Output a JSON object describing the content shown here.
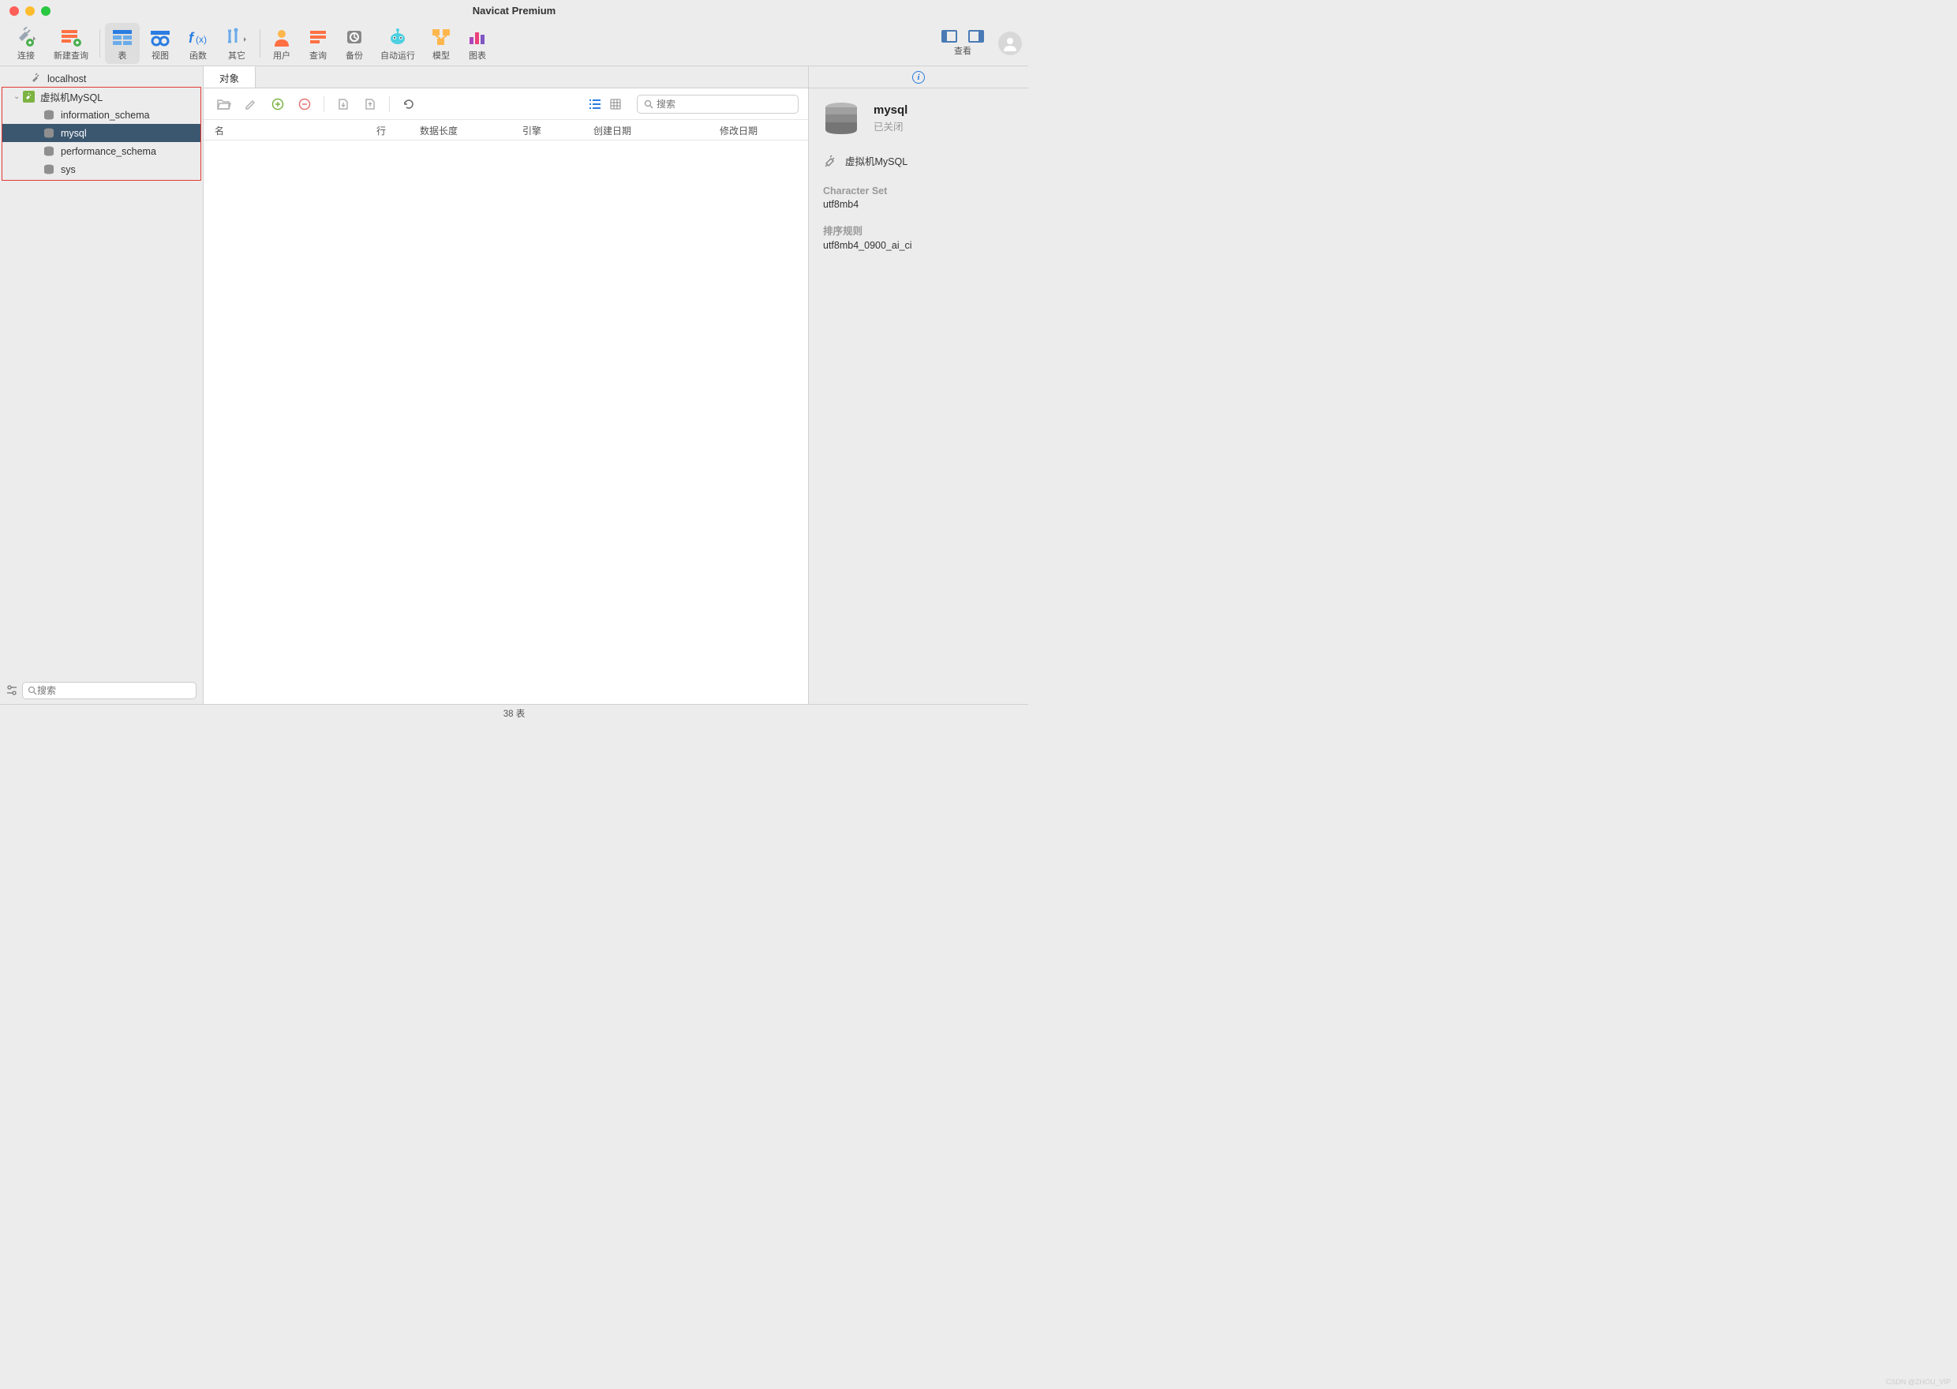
{
  "title": "Navicat Premium",
  "toolbar": {
    "connect": "连接",
    "newquery": "新建查询",
    "table": "表",
    "view": "视图",
    "function": "函数",
    "other": "其它",
    "user": "用户",
    "query": "查询",
    "backup": "备份",
    "automation": "自动运行",
    "model": "模型",
    "chart": "图表",
    "look": "查看"
  },
  "sidebar": {
    "localhost": "localhost",
    "connection": "虚拟机MySQL",
    "databases": [
      "information_schema",
      "mysql",
      "performance_schema",
      "sys"
    ],
    "search_placeholder": "搜索"
  },
  "tabs": {
    "objects": "对象"
  },
  "content": {
    "search_placeholder": "搜索",
    "columns": {
      "name": "名",
      "rows": "行",
      "datalen": "数据长度",
      "engine": "引擎",
      "created": "创建日期",
      "modified": "修改日期"
    }
  },
  "right": {
    "db_name": "mysql",
    "db_status": "已关闭",
    "connection": "虚拟机MySQL",
    "charset_label": "Character Set",
    "charset_value": "utf8mb4",
    "collation_label": "排序规则",
    "collation_value": "utf8mb4_0900_ai_ci"
  },
  "status": "38 表",
  "watermark": "CSDN @ZHOU_VIP"
}
